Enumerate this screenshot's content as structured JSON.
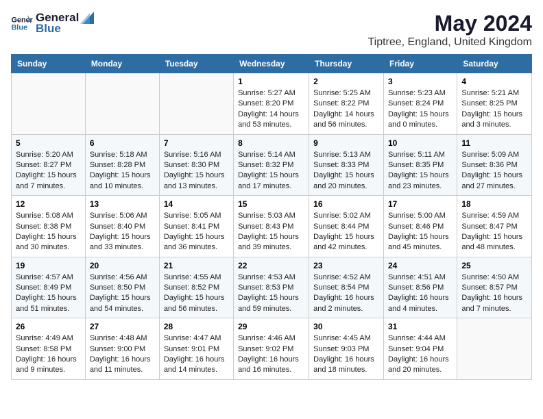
{
  "logo": {
    "line1": "General",
    "line2": "Blue"
  },
  "header": {
    "month": "May 2024",
    "location": "Tiptree, England, United Kingdom"
  },
  "weekdays": [
    "Sunday",
    "Monday",
    "Tuesday",
    "Wednesday",
    "Thursday",
    "Friday",
    "Saturday"
  ],
  "weeks": [
    [
      {
        "day": "",
        "info": ""
      },
      {
        "day": "",
        "info": ""
      },
      {
        "day": "",
        "info": ""
      },
      {
        "day": "1",
        "info": "Sunrise: 5:27 AM\nSunset: 8:20 PM\nDaylight: 14 hours and 53 minutes."
      },
      {
        "day": "2",
        "info": "Sunrise: 5:25 AM\nSunset: 8:22 PM\nDaylight: 14 hours and 56 minutes."
      },
      {
        "day": "3",
        "info": "Sunrise: 5:23 AM\nSunset: 8:24 PM\nDaylight: 15 hours and 0 minutes."
      },
      {
        "day": "4",
        "info": "Sunrise: 5:21 AM\nSunset: 8:25 PM\nDaylight: 15 hours and 3 minutes."
      }
    ],
    [
      {
        "day": "5",
        "info": "Sunrise: 5:20 AM\nSunset: 8:27 PM\nDaylight: 15 hours and 7 minutes."
      },
      {
        "day": "6",
        "info": "Sunrise: 5:18 AM\nSunset: 8:28 PM\nDaylight: 15 hours and 10 minutes."
      },
      {
        "day": "7",
        "info": "Sunrise: 5:16 AM\nSunset: 8:30 PM\nDaylight: 15 hours and 13 minutes."
      },
      {
        "day": "8",
        "info": "Sunrise: 5:14 AM\nSunset: 8:32 PM\nDaylight: 15 hours and 17 minutes."
      },
      {
        "day": "9",
        "info": "Sunrise: 5:13 AM\nSunset: 8:33 PM\nDaylight: 15 hours and 20 minutes."
      },
      {
        "day": "10",
        "info": "Sunrise: 5:11 AM\nSunset: 8:35 PM\nDaylight: 15 hours and 23 minutes."
      },
      {
        "day": "11",
        "info": "Sunrise: 5:09 AM\nSunset: 8:36 PM\nDaylight: 15 hours and 27 minutes."
      }
    ],
    [
      {
        "day": "12",
        "info": "Sunrise: 5:08 AM\nSunset: 8:38 PM\nDaylight: 15 hours and 30 minutes."
      },
      {
        "day": "13",
        "info": "Sunrise: 5:06 AM\nSunset: 8:40 PM\nDaylight: 15 hours and 33 minutes."
      },
      {
        "day": "14",
        "info": "Sunrise: 5:05 AM\nSunset: 8:41 PM\nDaylight: 15 hours and 36 minutes."
      },
      {
        "day": "15",
        "info": "Sunrise: 5:03 AM\nSunset: 8:43 PM\nDaylight: 15 hours and 39 minutes."
      },
      {
        "day": "16",
        "info": "Sunrise: 5:02 AM\nSunset: 8:44 PM\nDaylight: 15 hours and 42 minutes."
      },
      {
        "day": "17",
        "info": "Sunrise: 5:00 AM\nSunset: 8:46 PM\nDaylight: 15 hours and 45 minutes."
      },
      {
        "day": "18",
        "info": "Sunrise: 4:59 AM\nSunset: 8:47 PM\nDaylight: 15 hours and 48 minutes."
      }
    ],
    [
      {
        "day": "19",
        "info": "Sunrise: 4:57 AM\nSunset: 8:49 PM\nDaylight: 15 hours and 51 minutes."
      },
      {
        "day": "20",
        "info": "Sunrise: 4:56 AM\nSunset: 8:50 PM\nDaylight: 15 hours and 54 minutes."
      },
      {
        "day": "21",
        "info": "Sunrise: 4:55 AM\nSunset: 8:52 PM\nDaylight: 15 hours and 56 minutes."
      },
      {
        "day": "22",
        "info": "Sunrise: 4:53 AM\nSunset: 8:53 PM\nDaylight: 15 hours and 59 minutes."
      },
      {
        "day": "23",
        "info": "Sunrise: 4:52 AM\nSunset: 8:54 PM\nDaylight: 16 hours and 2 minutes."
      },
      {
        "day": "24",
        "info": "Sunrise: 4:51 AM\nSunset: 8:56 PM\nDaylight: 16 hours and 4 minutes."
      },
      {
        "day": "25",
        "info": "Sunrise: 4:50 AM\nSunset: 8:57 PM\nDaylight: 16 hours and 7 minutes."
      }
    ],
    [
      {
        "day": "26",
        "info": "Sunrise: 4:49 AM\nSunset: 8:58 PM\nDaylight: 16 hours and 9 minutes."
      },
      {
        "day": "27",
        "info": "Sunrise: 4:48 AM\nSunset: 9:00 PM\nDaylight: 16 hours and 11 minutes."
      },
      {
        "day": "28",
        "info": "Sunrise: 4:47 AM\nSunset: 9:01 PM\nDaylight: 16 hours and 14 minutes."
      },
      {
        "day": "29",
        "info": "Sunrise: 4:46 AM\nSunset: 9:02 PM\nDaylight: 16 hours and 16 minutes."
      },
      {
        "day": "30",
        "info": "Sunrise: 4:45 AM\nSunset: 9:03 PM\nDaylight: 16 hours and 18 minutes."
      },
      {
        "day": "31",
        "info": "Sunrise: 4:44 AM\nSunset: 9:04 PM\nDaylight: 16 hours and 20 minutes."
      },
      {
        "day": "",
        "info": ""
      }
    ]
  ]
}
